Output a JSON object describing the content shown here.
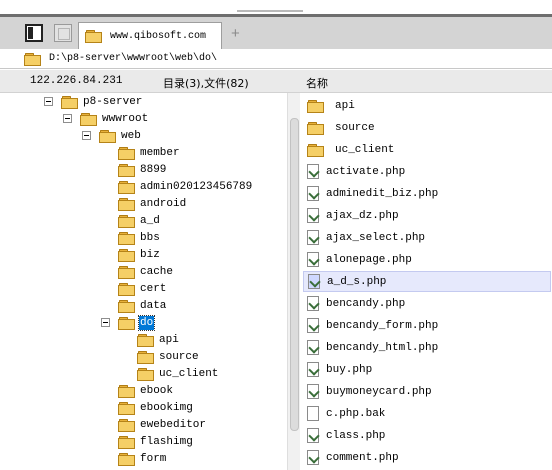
{
  "tabs": [
    {
      "label": "www.qibosoft.com"
    }
  ],
  "new_tab_label": "+",
  "address": {
    "path": "D:\\p8-server\\wwwroot\\web\\do\\"
  },
  "header": {
    "ip": "122.226.84.231",
    "count": "目录(3),文件(82)",
    "name_col": "名称"
  },
  "tree": [
    {
      "label": "p8-server",
      "state": "expanded"
    },
    {
      "label": "wwwroot",
      "state": "expanded"
    },
    {
      "label": "web",
      "state": "expanded"
    },
    {
      "label": "member",
      "state": "collapsed"
    },
    {
      "label": "8899",
      "state": "leaf"
    },
    {
      "label": "admin020123456789",
      "state": "leaf"
    },
    {
      "label": "android",
      "state": "leaf"
    },
    {
      "label": "a_d",
      "state": "leaf"
    },
    {
      "label": "bbs",
      "state": "collapsed"
    },
    {
      "label": "biz",
      "state": "leaf"
    },
    {
      "label": "cache",
      "state": "leaf"
    },
    {
      "label": "cert",
      "state": "leaf"
    },
    {
      "label": "data",
      "state": "collapsed"
    },
    {
      "label": "do",
      "state": "expanded",
      "selected": true
    },
    {
      "label": "api",
      "state": "leaf"
    },
    {
      "label": "source",
      "state": "leaf"
    },
    {
      "label": "uc_client",
      "state": "leaf"
    },
    {
      "label": "ebook",
      "state": "leaf"
    },
    {
      "label": "ebookimg",
      "state": "leaf"
    },
    {
      "label": "ewebeditor",
      "state": "leaf"
    },
    {
      "label": "flashimg",
      "state": "leaf"
    },
    {
      "label": "form",
      "state": "leaf"
    },
    {
      "label": "",
      "state": "leaf"
    }
  ],
  "files": [
    {
      "name": "api",
      "type": "folder"
    },
    {
      "name": "source",
      "type": "folder"
    },
    {
      "name": "uc_client",
      "type": "folder"
    },
    {
      "name": "activate.php",
      "type": "php"
    },
    {
      "name": "adminedit_biz.php",
      "type": "php"
    },
    {
      "name": "ajax_dz.php",
      "type": "php"
    },
    {
      "name": "ajax_select.php",
      "type": "php"
    },
    {
      "name": "alonepage.php",
      "type": "php"
    },
    {
      "name": "a_d_s.php",
      "type": "php",
      "selected": true
    },
    {
      "name": "bencandy.php",
      "type": "php"
    },
    {
      "name": "bencandy_form.php",
      "type": "php"
    },
    {
      "name": "bencandy_html.php",
      "type": "php"
    },
    {
      "name": "buy.php",
      "type": "php"
    },
    {
      "name": "buymoneycard.php",
      "type": "php"
    },
    {
      "name": "c.php.bak",
      "type": "blank"
    },
    {
      "name": "class.php",
      "type": "php"
    },
    {
      "name": "comment.php",
      "type": "php"
    }
  ],
  "colors": {
    "selection": "#0078d7",
    "folder": "#f5cf66",
    "row_highlight": "#e6e9fc"
  }
}
